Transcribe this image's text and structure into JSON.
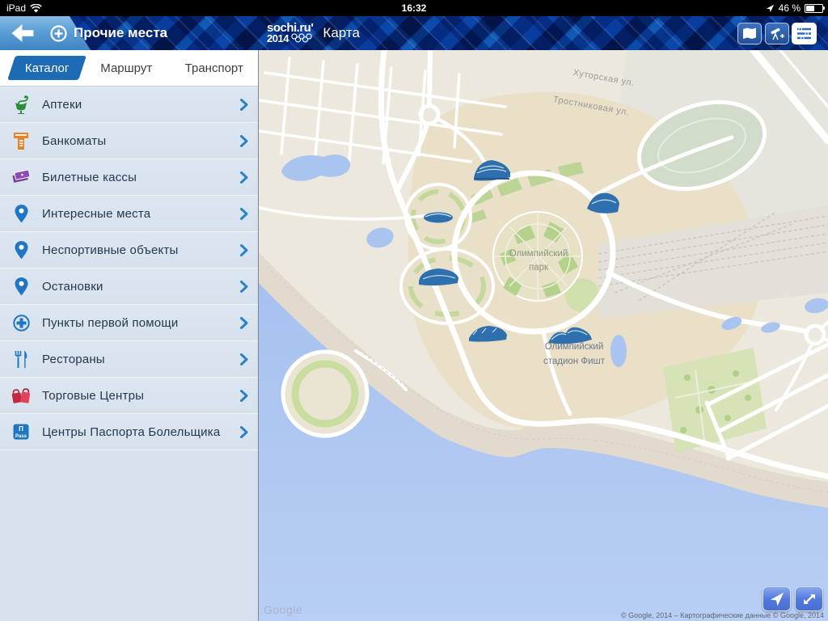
{
  "status_bar": {
    "device": "iPad",
    "time": "16:32",
    "battery": "46 %"
  },
  "nav": {
    "add_place_label": "Прочие места",
    "logo_top": "sochi.ru'",
    "logo_bottom": "2014",
    "title": "Карта"
  },
  "sidebar": {
    "tabs": [
      {
        "label": "Каталог",
        "active": true
      },
      {
        "label": "Маршрут",
        "active": false
      },
      {
        "label": "Транспорт",
        "active": false
      }
    ]
  },
  "catalog": {
    "items": [
      {
        "label": "Аптеки",
        "icon": "pharmacy"
      },
      {
        "label": "Банкоматы",
        "icon": "atm"
      },
      {
        "label": "Билетные кассы",
        "icon": "tickets"
      },
      {
        "label": "Интересные места",
        "icon": "pin"
      },
      {
        "label": "Неспортивные объекты",
        "icon": "pin"
      },
      {
        "label": "Остановки",
        "icon": "pin"
      },
      {
        "label": "Пункты первой помощи",
        "icon": "first-aid"
      },
      {
        "label": "Рестораны",
        "icon": "restaurant"
      },
      {
        "label": "Торговые Центры",
        "icon": "shopping"
      },
      {
        "label": "Центры Паспорта Болельщика",
        "icon": "fan-pass"
      }
    ],
    "pass_icon_top": "П",
    "pass_icon_bottom": "Pass"
  },
  "map": {
    "street_1": "Хуторская ул.",
    "street_2": "Тростниковая ул.",
    "park_line1": "Олимпийский",
    "park_line2": "парк",
    "stadium_line1": "Олимпийский",
    "stadium_line2": "стадион Фишт",
    "watermark": "Google",
    "attribution": "© Google, 2014 – Картографические данные © Google, 2014"
  },
  "colors": {
    "accent_blue": "#1d6ab5",
    "nav_blue": "#1d64b2",
    "water": "#aac5f1",
    "land": "#ece8dd",
    "park_tan": "#eadfc7",
    "green": "#cfe0ad",
    "venue_blue": "#2e6fae"
  }
}
